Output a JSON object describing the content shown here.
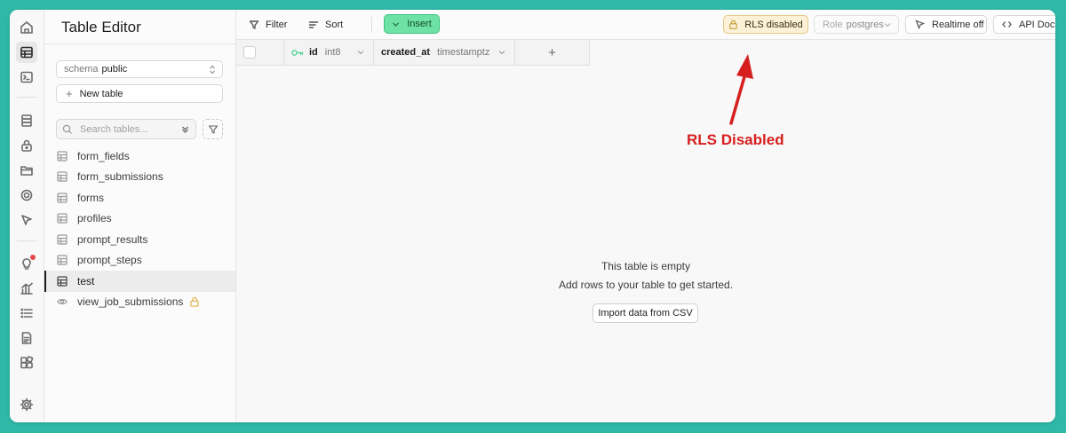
{
  "sidebar": {
    "title": "Table Editor",
    "schema": {
      "label": "schema",
      "value": "public"
    },
    "new_table_label": "New table",
    "search_placeholder": "Search tables...",
    "tables": [
      {
        "name": "form_fields"
      },
      {
        "name": "form_submissions"
      },
      {
        "name": "forms"
      },
      {
        "name": "profiles"
      },
      {
        "name": "prompt_results"
      },
      {
        "name": "prompt_steps"
      },
      {
        "name": "test",
        "active": true
      },
      {
        "name": "view_job_submissions",
        "is_view": true
      }
    ]
  },
  "toolbar": {
    "filter_label": "Filter",
    "sort_label": "Sort",
    "insert_label": "Insert",
    "rls_label": "RLS disabled",
    "role_label": "Role",
    "role_value": "postgres",
    "realtime_label": "Realtime off",
    "api_docs_label": "API Docs"
  },
  "grid": {
    "columns": [
      {
        "name": "id",
        "type": "int8",
        "primary_key": true
      },
      {
        "name": "created_at",
        "type": "timestamptz"
      }
    ],
    "add_column_label": "+"
  },
  "empty_state": {
    "title": "This table is empty",
    "subtitle": "Add rows to your table to get started.",
    "import_button": "Import data from CSV"
  },
  "annotation": {
    "text": "RLS Disabled",
    "color": "#d71e1e"
  },
  "colors": {
    "background": "#2fb8a8",
    "insert_button": "#6ee2a4",
    "rls_badge": "#fbf1d9"
  }
}
